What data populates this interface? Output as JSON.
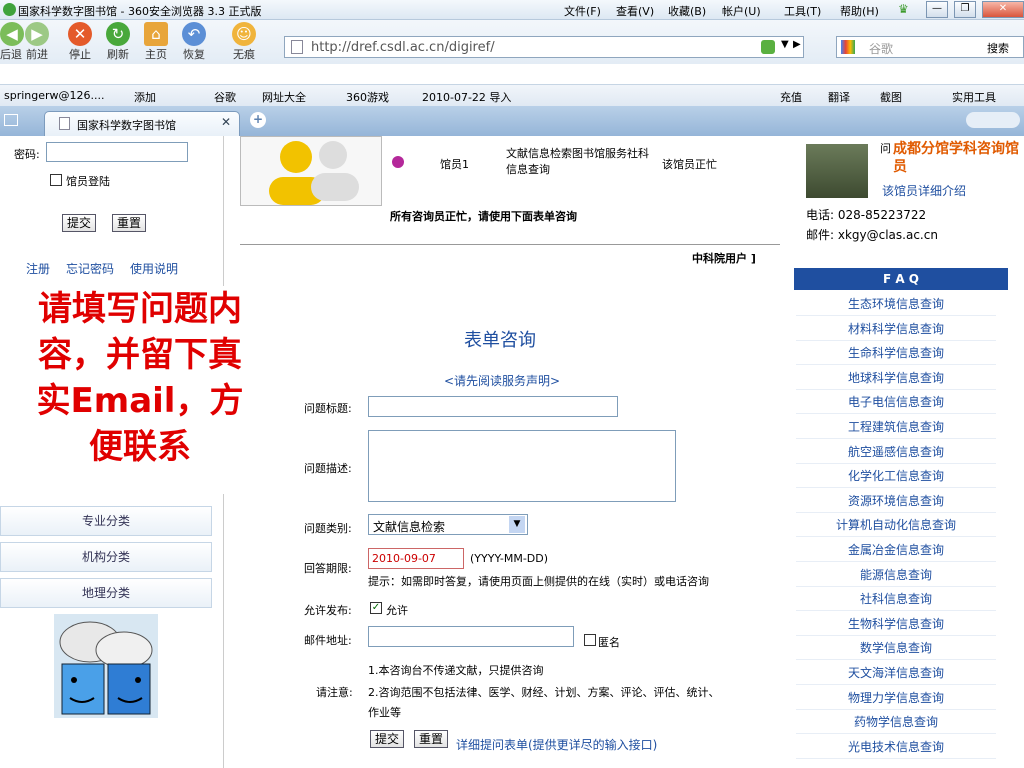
{
  "window": {
    "title": "国家科学数字图书馆 - 360安全浏览器 3.3 正式版",
    "menu": [
      "文件(F)",
      "查看(V)",
      "收藏(B)",
      "帐户(U)",
      "工具(T)",
      "帮助(H)"
    ]
  },
  "toolbar": {
    "back": "后退",
    "forward": "前进",
    "stop": "停止",
    "refresh": "刷新",
    "home": "主页",
    "restore": "恢复",
    "incognito": "无痕"
  },
  "address": {
    "url": "http://dref.csdl.ac.cn/digiref/"
  },
  "search": {
    "placeholder": "谷歌",
    "button": "搜索"
  },
  "favorites": {
    "items": [
      "springerw@126....",
      "添加",
      "谷歌",
      "网址大全",
      "360游戏",
      "2010-07-22 导入"
    ],
    "right_items": [
      "充值",
      "翻译",
      "截图",
      "实用工具"
    ]
  },
  "tab": {
    "label": "国家科学数字图书馆"
  },
  "left": {
    "password_label": "密码:",
    "librarian_login": "馆员登陆",
    "submit": "提交",
    "reset": "重置",
    "links": [
      "注册",
      "忘记密码",
      "使用说明"
    ],
    "categories": [
      "专业分类",
      "机构分类",
      "地理分类"
    ]
  },
  "overlay": {
    "lines": [
      "请填写问题内",
      "容，并留下真",
      "实Email，方",
      "便联系"
    ]
  },
  "librarian": {
    "name": "馆员1",
    "service": "文献信息检索图书馆服务社科信息查询",
    "status": "该馆员正忙",
    "notice": "所有咨询员正忙，请使用下面表单咨询",
    "user_type": "中科院用户 ]"
  },
  "form": {
    "title": "表单咨询",
    "statement": "<请先阅读服务声明>",
    "q_title_label": "问题标题:",
    "q_desc_label": "问题描述:",
    "q_category_label": "问题类别:",
    "q_category_value": "文献信息检索",
    "deadline_label": "回答期限:",
    "deadline_value": "2010-09-07",
    "deadline_format": "(YYYY-MM-DD)",
    "deadline_hint": "提示：如需即时答复，请使用页面上侧提供的在线（实时）或电话咨询",
    "publish_label": "允许发布:",
    "publish_value": "允许",
    "email_label": "邮件地址:",
    "anonymous": "匿名",
    "note_label": "请注意:",
    "notes": [
      "1.本咨询台不传递文献，只提供咨询",
      "2.咨询范围不包括法律、医学、财经、计划、方案、评论、评估、统计、",
      "作业等"
    ],
    "submit": "提交",
    "reset": "重置",
    "detail_link": "详细提问表单(提供更详尽的输入接口)"
  },
  "branch": {
    "prefix": "问",
    "name": "成都分馆学科咨询馆员",
    "detail": "该馆员详细介绍",
    "phone": "电话: 028-85223722",
    "email": "邮件: xkgy@clas.ac.cn"
  },
  "faq": {
    "header": "F A Q",
    "items": [
      "生态环境信息查询",
      "材料科学信息查询",
      "生命科学信息查询",
      "地球科学信息查询",
      "电子电信信息查询",
      "工程建筑信息查询",
      "航空遥感信息查询",
      "化学化工信息查询",
      "资源环境信息查询",
      "计算机自动化信息查询",
      "金属冶金信息查询",
      "能源信息查询",
      "社科信息查询",
      "生物科学信息查询",
      "数学信息查询",
      "天文海洋信息查询",
      "物理力学信息查询",
      "药物学信息查询",
      "光电技术信息查询"
    ]
  },
  "colors": {
    "accent_red": "#e00000",
    "faq_header": "#1f4fa0",
    "link": "#1f4fa0"
  }
}
